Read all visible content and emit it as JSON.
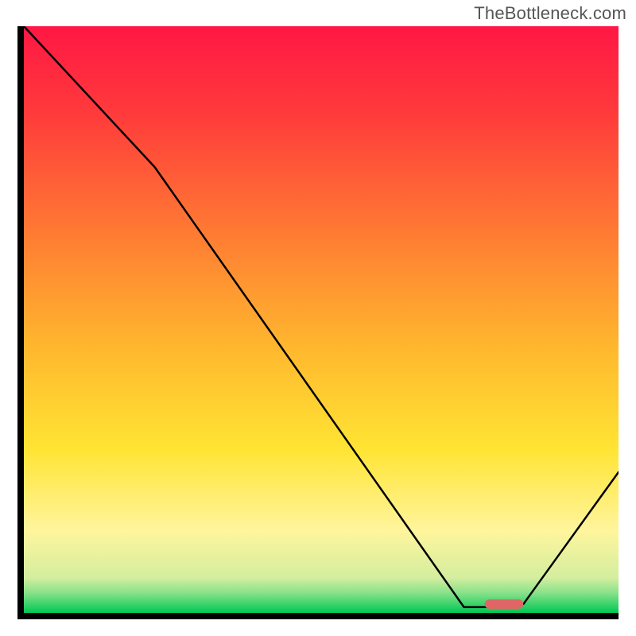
{
  "watermark": "TheBottleneck.com",
  "chart_data": {
    "type": "line",
    "title": "",
    "xlabel": "",
    "ylabel": "",
    "xlim": [
      0,
      100
    ],
    "ylim": [
      0,
      100
    ],
    "series": [
      {
        "name": "curve",
        "x": [
          0,
          22,
          74,
          78,
          84,
          100
        ],
        "y": [
          100,
          76,
          1,
          1,
          1.5,
          24
        ]
      }
    ],
    "marker": {
      "x_start": 77.5,
      "x_end": 84,
      "y": 1.5,
      "color": "#e06666"
    },
    "gradient_stops": [
      {
        "offset": 0.0,
        "color": "#ff1744"
      },
      {
        "offset": 0.15,
        "color": "#ff3b3b"
      },
      {
        "offset": 0.35,
        "color": "#ff7a33"
      },
      {
        "offset": 0.55,
        "color": "#ffb82e"
      },
      {
        "offset": 0.72,
        "color": "#ffe433"
      },
      {
        "offset": 0.86,
        "color": "#fff59d"
      },
      {
        "offset": 0.94,
        "color": "#d4ee9f"
      },
      {
        "offset": 0.965,
        "color": "#8be28b"
      },
      {
        "offset": 1.0,
        "color": "#00c853"
      }
    ],
    "axes": {
      "x": true,
      "y": true
    },
    "axis_color": "#000000",
    "axis_thickness": 8
  }
}
